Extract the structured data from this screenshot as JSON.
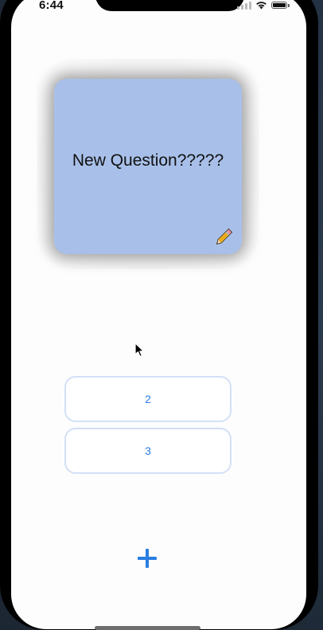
{
  "status_bar": {
    "time": "6:44",
    "icons": [
      "cellular-signal-icon",
      "wifi-icon",
      "battery-icon"
    ]
  },
  "card": {
    "question": "New Question?????",
    "edit_icon": "pencil-icon",
    "background_color": "#a8c0e9"
  },
  "answers": [
    {
      "label": "2"
    },
    {
      "label": "3"
    }
  ],
  "add_button": {
    "icon": "plus-icon",
    "color": "#2a7de1"
  },
  "colors": {
    "accent": "#2a7de1",
    "answer_border": "#d3e0f5"
  }
}
